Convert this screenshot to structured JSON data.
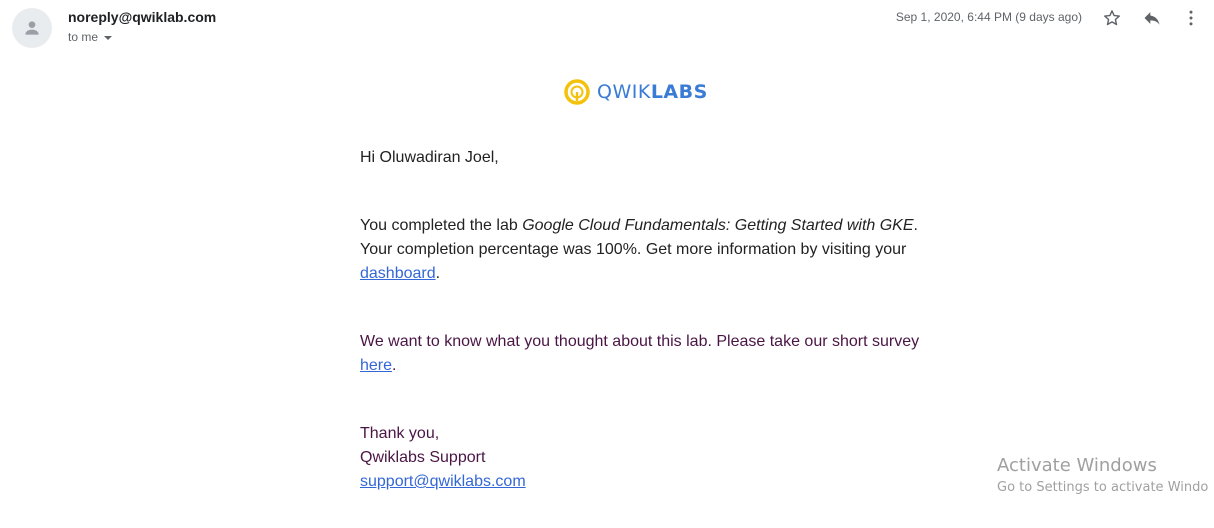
{
  "header": {
    "sender": "noreply@qwiklab.com",
    "recipient_label": "to me",
    "date": "Sep 1, 2020, 6:44 PM (9 days ago)",
    "icons": [
      "avatar-icon",
      "star-icon",
      "reply-icon",
      "more-vert-icon",
      "chevron-down-icon"
    ]
  },
  "logo": {
    "text_light": "QWIK",
    "text_bold": "LABS",
    "colors": {
      "ring": "#f4c20d",
      "text": "#3a7bd5"
    }
  },
  "email": {
    "greeting": "Hi Oluwadiran Joel,",
    "para1": {
      "prefix": "You completed the lab ",
      "lab_name": "Google Cloud Fundamentals: Getting Started with GKE",
      "middle": ". Your completion percentage was 100%. Get more information by visiting your ",
      "link": "dashboard",
      "suffix": "."
    },
    "para2": {
      "prefix": "We want to know what you thought about this lab. Please take our short survey ",
      "link": "here",
      "suffix": "."
    },
    "sign_off": {
      "thanks": "Thank you,",
      "team": "Qwiklabs Support",
      "email_link": "support@qwiklabs.com"
    }
  },
  "watermark": {
    "line1": "Activate Windows",
    "line2": "Go to Settings to activate Windo"
  }
}
